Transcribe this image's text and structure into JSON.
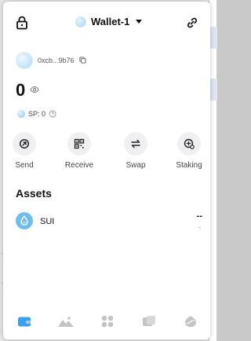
{
  "header": {
    "wallet_name": "Wallet-1",
    "lock_icon": "lock-icon",
    "link_icon": "link-icon"
  },
  "account": {
    "address": "0xcb...9b76",
    "copy_icon": "copy-icon"
  },
  "balance": {
    "amount": "0",
    "eye_icon": "eye-icon"
  },
  "sp": {
    "label": "SP: 0",
    "info_icon": "info-icon"
  },
  "actions": [
    {
      "label": "Send",
      "icon": "send-icon"
    },
    {
      "label": "Receive",
      "icon": "qr-code-icon"
    },
    {
      "label": "Swap",
      "icon": "swap-icon"
    },
    {
      "label": "Staking",
      "icon": "staking-icon"
    }
  ],
  "assets": {
    "title": "Assets",
    "items": [
      {
        "name": "SUI",
        "value": "--",
        "sub_value": "-",
        "icon": "sui-drop-icon"
      }
    ]
  },
  "nav": [
    {
      "name": "wallet",
      "icon": "wallet-icon",
      "active": true
    },
    {
      "name": "nft",
      "icon": "mountains-icon",
      "active": false
    },
    {
      "name": "apps",
      "icon": "apps-grid-icon",
      "active": false
    },
    {
      "name": "activity",
      "icon": "cards-icon",
      "active": false
    },
    {
      "name": "network",
      "icon": "globe-icon",
      "active": false
    }
  ],
  "colors": {
    "accent": "#6fbcf0",
    "nav_active": "#3aa0f0",
    "nav_inactive": "#c4c4c8"
  }
}
